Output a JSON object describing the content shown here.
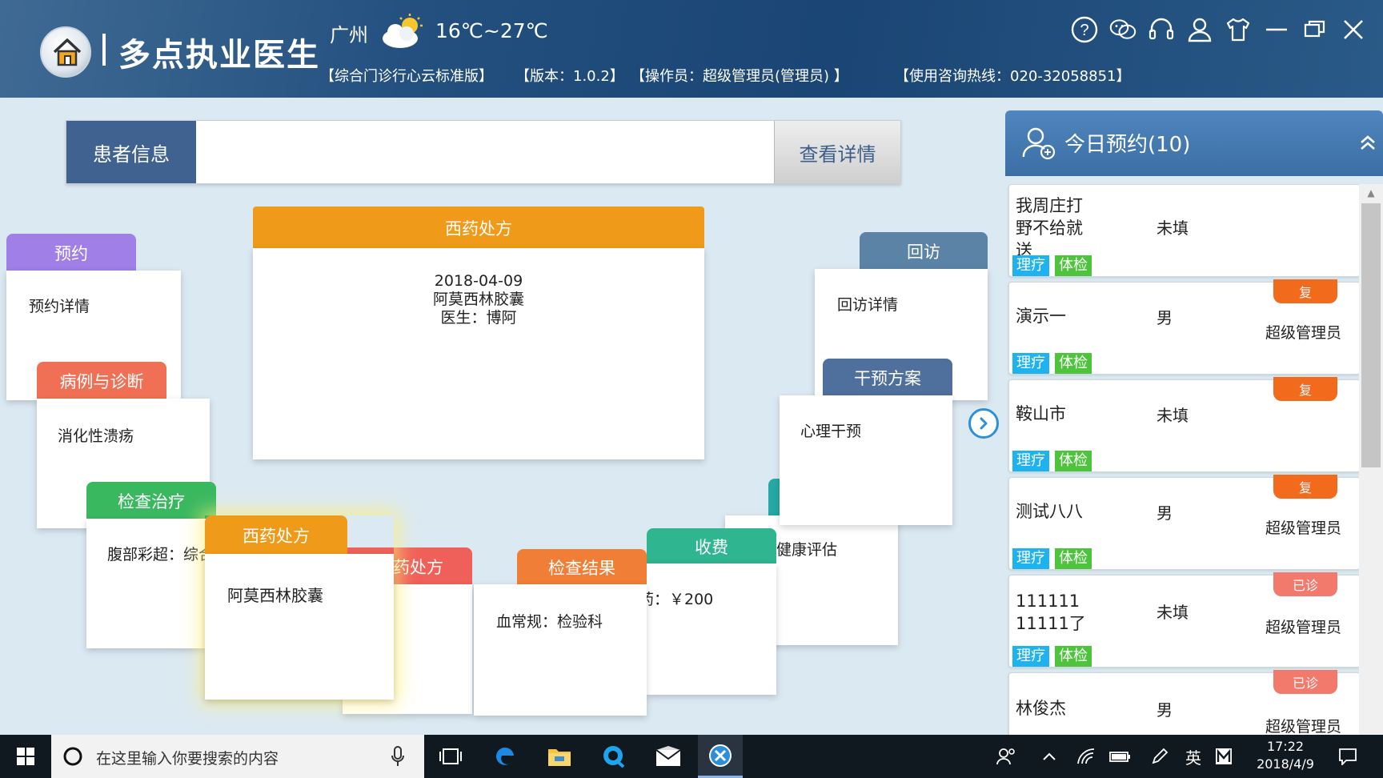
{
  "header": {
    "app_title": "多点执业医生",
    "city": "广州",
    "temperature": "16℃~27℃",
    "edition": "【综合门诊行心云标准版】",
    "version": "【版本：1.0.2】",
    "operator": "【操作员：超级管理员(管理员) 】",
    "hotline": "【使用咨询热线：020-32058851】"
  },
  "patient": {
    "label": "患者信息",
    "input_value": "",
    "detail_button": "查看详情"
  },
  "cards": {
    "main_rx": {
      "title": "西药处方",
      "date": "2018-04-09",
      "drug": "阿莫西林胶囊",
      "doctor": "医生：博阿"
    },
    "appointment": {
      "title": "预约",
      "body": "预约详情"
    },
    "diagnosis": {
      "title": "病例与诊断",
      "body": "消化性溃疡"
    },
    "exam": {
      "title": "检查治疗",
      "body": "腹部彩超：综合"
    },
    "rx_front": {
      "title": "西药处方",
      "body": "阿莫西林胶囊"
    },
    "rx_back": {
      "title": "药处方"
    },
    "result": {
      "title": "检查结果",
      "body": "血常规：检验科"
    },
    "fee": {
      "title": "收费",
      "body": "药：￥200"
    },
    "health": {
      "body": "健康评估"
    },
    "intervention": {
      "title": "干预方案",
      "body": "心理干预"
    },
    "followup": {
      "title": "回访",
      "body": "回访详情"
    }
  },
  "appointments": {
    "title": "今日预约(10)",
    "items": [
      {
        "name": "我周庄打\n野不给就\n送",
        "gender": "未填",
        "operator": "",
        "badge": "",
        "tag1": "理疗",
        "tag2": "体检"
      },
      {
        "name": "演示一",
        "gender": "男",
        "operator": "超级管理员",
        "badge": "复",
        "tag1": "理疗",
        "tag2": "体检"
      },
      {
        "name": "鞍山市",
        "gender": "未填",
        "operator": "",
        "badge": "复",
        "tag1": "理疗",
        "tag2": "体检"
      },
      {
        "name": "测试八八",
        "gender": "男",
        "operator": "超级管理员",
        "badge": "复",
        "tag1": "理疗",
        "tag2": "体检"
      },
      {
        "name": "111111\n11111了",
        "gender": "未填",
        "operator": "超级管理员",
        "badge": "已诊",
        "tag1": "理疗",
        "tag2": "体检"
      },
      {
        "name": "林俊杰",
        "gender": "男",
        "operator": "超级管理员",
        "badge": "已诊",
        "tag1": "",
        "tag2": ""
      }
    ]
  },
  "taskbar": {
    "search_placeholder": "在这里输入你要搜索的内容",
    "ime": "英",
    "time": "17:22",
    "date": "2018/4/9"
  },
  "colors": {
    "header": "#23507f",
    "purple": "#a07fe6",
    "coral": "#f07055",
    "green": "#39b860",
    "orange": "#f09a1a",
    "red": "#f0605a",
    "orange_deep": "#f07e36",
    "teal": "#2fb58f",
    "slate": "#4f6f9c",
    "steel": "#5b83a6"
  }
}
